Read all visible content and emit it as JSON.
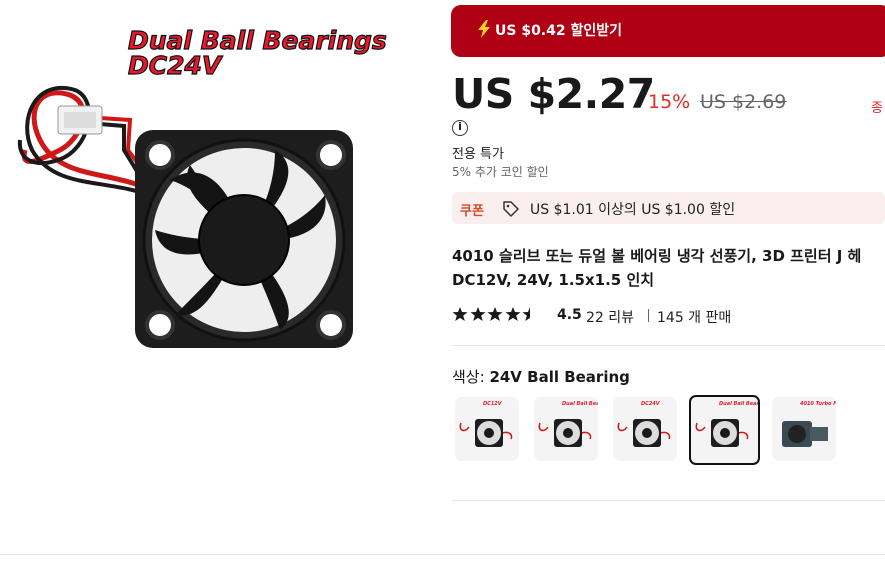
{
  "image": {
    "promo_line1": "Dual Ball Bearings",
    "promo_line2": "DC24V"
  },
  "coin_banner": {
    "text": "US $0.42 할인받기",
    "icon": "lightning-bolt-icon",
    "color": "#b00014"
  },
  "price": {
    "current": "US $2.27",
    "discount": "15%",
    "original": "US $2.69",
    "edge_text": "종"
  },
  "offer": {
    "info_icon": "i",
    "special_label": "전용 특가",
    "coin_extra": "5% 추가 코인 할인"
  },
  "coupon": {
    "label": "쿠폰",
    "icon": "tag-icon",
    "text": "US $1.01 이상의 US $1.00 할인"
  },
  "product": {
    "title_line1": "4010 슬리브 또는 듀얼 볼 베어링 냉각 선풍기, 3D 프린터 J 헤",
    "title_line2": "DC12V, 24V, 1.5x1.5 인치"
  },
  "rating": {
    "value": "4.5",
    "stars": 4.5,
    "reviews": "22 리뷰",
    "sold": "145 개 판매"
  },
  "color": {
    "label": "색상:",
    "selected": "24V Ball Bearing"
  },
  "variants": [
    {
      "label": "DC12V",
      "selected": false
    },
    {
      "label": "Dual Ball Bearings DC12V",
      "selected": false
    },
    {
      "label": "DC24V",
      "selected": false
    },
    {
      "label": "Dual Ball Bearings DC24V",
      "selected": true
    },
    {
      "label": "4010 Turbo Fan",
      "selected": false
    }
  ]
}
